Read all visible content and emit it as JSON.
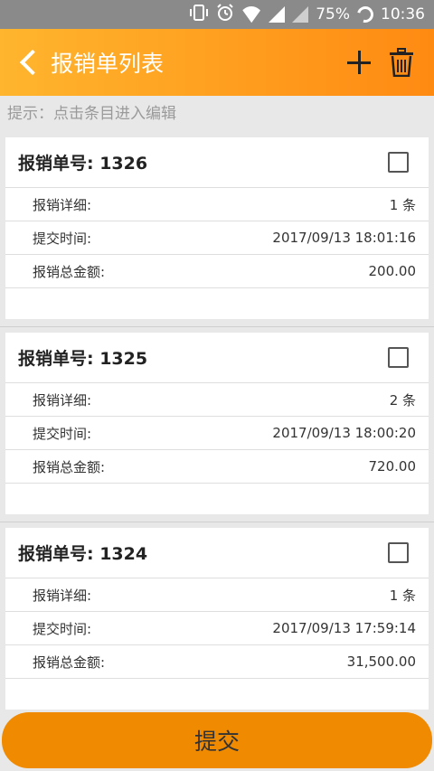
{
  "status_bar": {
    "battery": "75%",
    "time": "10:36"
  },
  "nav": {
    "title": "报销单列表"
  },
  "hint": "提示：点击条目进入编辑",
  "cards": [
    {
      "title": "报销单号: 1326",
      "rows": [
        {
          "label": "报销详细:",
          "value": "1 条"
        },
        {
          "label": "提交时间:",
          "value": "2017/09/13 18:01:16"
        },
        {
          "label": "报销总金额:",
          "value": "200.00"
        }
      ]
    },
    {
      "title": "报销单号: 1325",
      "rows": [
        {
          "label": "报销详细:",
          "value": "2 条"
        },
        {
          "label": "提交时间:",
          "value": "2017/09/13 18:00:20"
        },
        {
          "label": "报销总金额:",
          "value": "720.00"
        }
      ]
    },
    {
      "title": "报销单号: 1324",
      "rows": [
        {
          "label": "报销详细:",
          "value": "1 条"
        },
        {
          "label": "提交时间:",
          "value": "2017/09/13 17:59:14"
        },
        {
          "label": "报销总金额:",
          "value": "31,500.00"
        }
      ]
    }
  ],
  "submit_label": "提交"
}
